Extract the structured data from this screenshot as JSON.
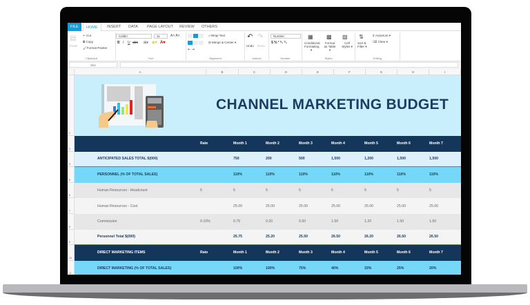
{
  "ribbon": {
    "tabs": [
      "FILE",
      "HOME",
      "INSERT",
      "DATA",
      "PAGE LAYOUT",
      "REVIEW",
      "OTHERS"
    ],
    "clipboard": {
      "paste": "Paste",
      "cut": "Cut",
      "copy": "Copy",
      "format_painter": "Format Painter",
      "label": "Clipboard"
    },
    "font": {
      "name": "Calibri",
      "size": "11",
      "label": "Font"
    },
    "alignment": {
      "wrap": "Wrap Text",
      "merge": "Merge & Center",
      "label": "Alignment"
    },
    "actions": {
      "undo": "Undo",
      "redo": "Redo",
      "label": "Actions"
    },
    "number": {
      "format": "Number",
      "label": "Number"
    },
    "styles": {
      "conditional": "Conditional Formatting ▾",
      "format_table": "Format as Table ▾",
      "cell_styles": "Cell Styles ▾",
      "label": "Styles"
    },
    "editing": {
      "sort": "Sort & Filter ▾",
      "autosum": "AutoSum ▾",
      "clear": "Clear ▾",
      "label": "Editing"
    }
  },
  "formula_bar": {
    "name_box": "R20",
    "formula": ""
  },
  "columns": [
    "A",
    "B",
    "C",
    "D",
    "E",
    "F",
    "G",
    "H",
    "I"
  ],
  "sheet": {
    "title": "CHANNEL MARKETING BUDGET",
    "rows": [
      {
        "num": "2",
        "style": "dark",
        "label": "",
        "rate": "Rate",
        "values": [
          "Month 1",
          "Month 2",
          "Month 3",
          "Month 4",
          "Month 5",
          "Month 6",
          "Month 7"
        ]
      },
      {
        "num": "3",
        "style": "light",
        "label": "ANTICIPATED SALES TOTAL $(000)",
        "rate": "",
        "values": [
          "750",
          "200",
          "500",
          "1,500",
          "1,200",
          "1,500",
          "1,500"
        ]
      },
      {
        "num": "5",
        "style": "cyan",
        "label": "PERSONNEL (% OF TOTAL SALES)",
        "rate": "",
        "values": [
          "110%",
          "110%",
          "110%",
          "110%",
          "110%",
          "110%",
          "110%"
        ]
      },
      {
        "num": "6",
        "style": "g1",
        "label": "Human Resources - Headcount",
        "rate": "5",
        "values": [
          "5",
          "5",
          "5",
          "5",
          "5",
          "5",
          "5"
        ]
      },
      {
        "num": "7",
        "style": "g2",
        "label": "Human Resources - Cost",
        "rate": "",
        "values": [
          "25.00",
          "25.00",
          "25.00",
          "25.00",
          "25.00",
          "25.00",
          "25.00"
        ]
      },
      {
        "num": "8",
        "style": "g1",
        "label": "Commission",
        "rate": "0.10%",
        "values": [
          "0.75",
          "0.20",
          "0.50",
          "1.50",
          "1.20",
          "1.50",
          "1.50"
        ]
      },
      {
        "num": "9",
        "style": "tot",
        "label": "Personnel Total $(000)",
        "rate": "",
        "values": [
          "25.75",
          "25.20",
          "25.50",
          "26.50",
          "26.20",
          "26.50",
          "26.50"
        ]
      },
      {
        "num": "10",
        "style": "dark",
        "label": "DIRECT MARKETING ITEMS",
        "rate": "Rate",
        "values": [
          "Month 1",
          "Month 2",
          "Month 3",
          "Month 4",
          "Month 5",
          "Month 6",
          "Month 7"
        ]
      },
      {
        "num": "11",
        "style": "cyan",
        "label": "DIRECT MARKETING (% OF TOTAL SALES)",
        "rate": "",
        "values": [
          "100%",
          "100%",
          "75%",
          "40%",
          "33%",
          "25%",
          "20%"
        ]
      }
    ]
  }
}
